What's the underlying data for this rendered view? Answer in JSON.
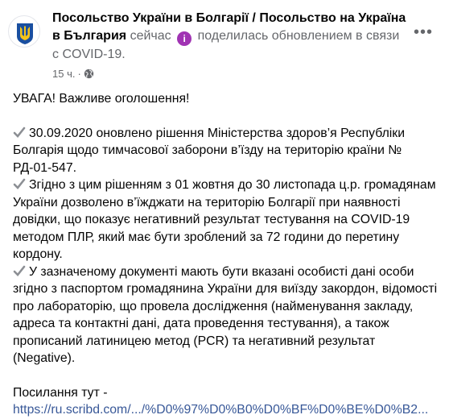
{
  "post": {
    "page_name": "Посольство України в Болгарії / Посольство на Україна в България",
    "time_now": "сейчас",
    "action_text": "поделилась обновлением в связи с COVID-19.",
    "timestamp": "15 ч.",
    "separator": "·",
    "alert_heading": "УВАГА! Важливе оголошення!",
    "items": [
      "30.09.2020 оновлено рішення Міністерства здоров’я Республіки Болгарія щодо тимчасової заборони в’їзду на територію країни № РД-01-547.",
      "Згідно з цим рішенням з 01 жовтня до 30 листопада ц.р. громадянам України дозволено в’їжджати на територію Болгарії при наявності довідки, що показує негативний результат тестування на COVID-19 методом ПЛР, який має бути зроблений за 72 години до перетину кордону.",
      "У зазначеному документі мають бути вказані особисті дані особи згідно з паспортом громадянина України для виїзду закордон, відомості про лабораторію, що провела дослідження (найменування закладу, адреса та контактні дані, дата проведення тестування), а також прописаний латиницею метод (PCR) та негативний результат (Negative)."
    ],
    "link_label": "Посилання тут -",
    "link_url": "https://ru.scribd.com/.../%D0%97%D0%B0%D0%BF%D0%BE%D0%B2..."
  },
  "icons": {
    "avatar": "ukraine-trident-avatar",
    "updated": "covid-info-icon",
    "globe": "globe-icon",
    "more": "more-options-icon",
    "check": "check-mark-icon"
  },
  "colors": {
    "link": "#385898",
    "secondary_text": "#65676b",
    "check": "#8c8f94",
    "trident_blue": "#1a4fa0",
    "trident_yellow": "#f5c518"
  }
}
